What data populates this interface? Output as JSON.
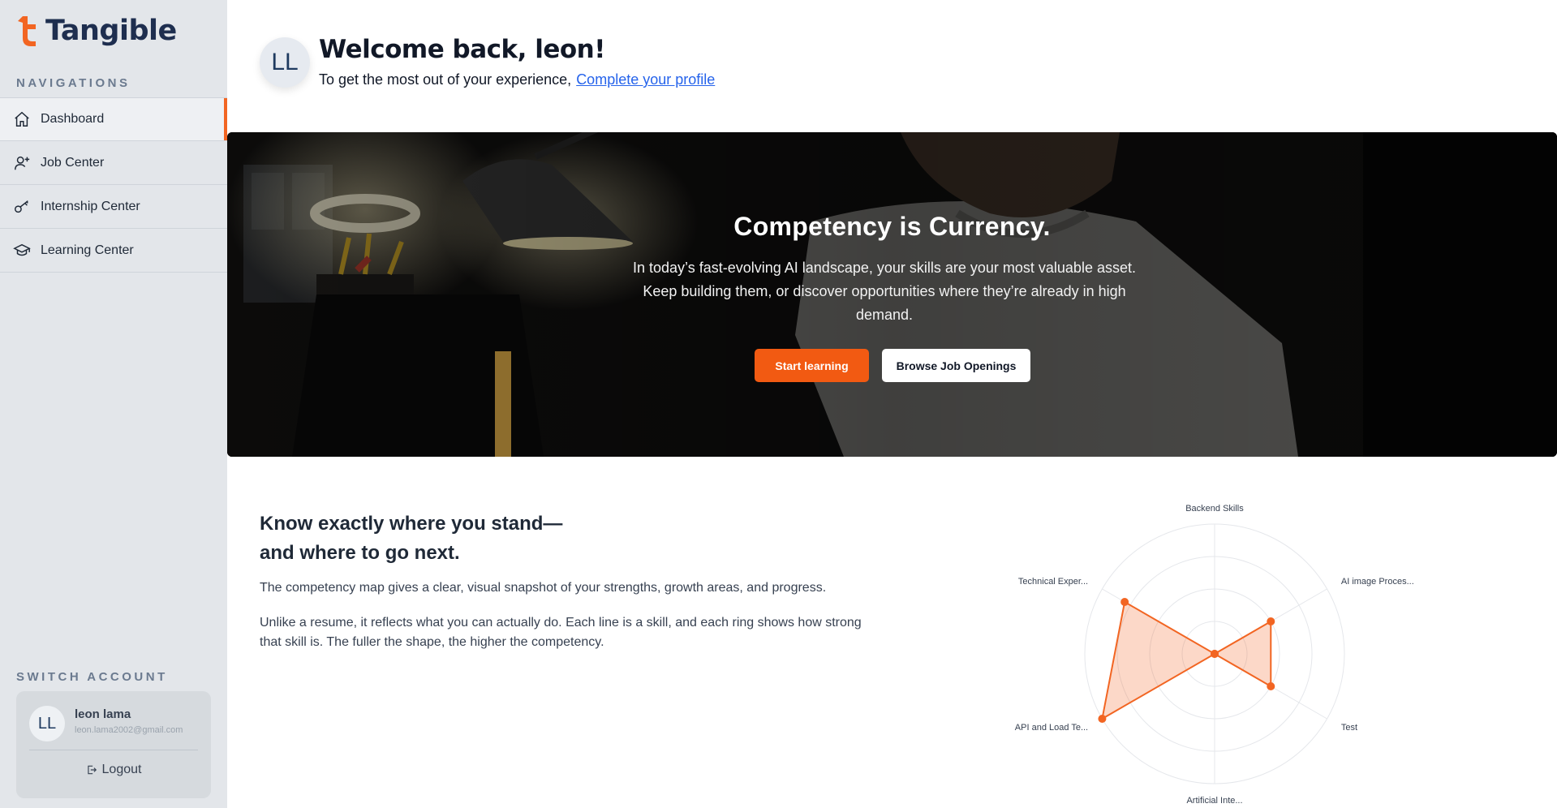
{
  "brand": {
    "name": "Tangible",
    "accent": "#f26522",
    "dark": "#1e2e4f"
  },
  "sidebar": {
    "nav_heading": "NAVIGATIONS",
    "items": [
      {
        "label": "Dashboard",
        "icon": "home-icon",
        "active": true
      },
      {
        "label": "Job Center",
        "icon": "user-plus-icon",
        "active": false
      },
      {
        "label": "Internship Center",
        "icon": "key-icon",
        "active": false
      },
      {
        "label": "Learning Center",
        "icon": "graduation-cap-icon",
        "active": false
      }
    ],
    "switch_heading": "SWITCH ACCOUNT",
    "account": {
      "initials": "LL",
      "name": "leon lama",
      "email": "leon.lama2002@gmail.com",
      "logout_label": "Logout"
    }
  },
  "header": {
    "avatar_initials": "LL",
    "title": "Welcome back, leon!",
    "subtitle": "To get the most out of your experience,",
    "profile_link": "Complete your profile"
  },
  "hero": {
    "title": "Competency is Currency.",
    "text": "In today’s fast-evolving AI landscape, your skills are your most valuable asset. Keep building them, or discover opportunities where they’re already in high demand.",
    "primary_button": "Start learning",
    "secondary_button": "Browse Job Openings"
  },
  "competency": {
    "title_line1": "Know exactly where you stand—",
    "title_line2": "and where to go next.",
    "paragraph1": "The competency map gives a clear, visual snapshot of your strengths, growth areas, and progress.",
    "paragraph2": "Unlike a resume, it reflects what you can actually do. Each line is a skill, and each ring shows how strong that skill is. The fuller the shape, the higher the competency."
  },
  "chart_data": {
    "type": "radar",
    "axes": [
      "Backend Skills",
      "AI image Proces...",
      "Test",
      "Artificial Inte...",
      "API and Load Te...",
      "Technical Exper..."
    ],
    "values": [
      0,
      0.5,
      0.5,
      0,
      1.0,
      0.8
    ],
    "range": [
      0,
      1
    ],
    "rings": 4,
    "color": "#f26522"
  }
}
